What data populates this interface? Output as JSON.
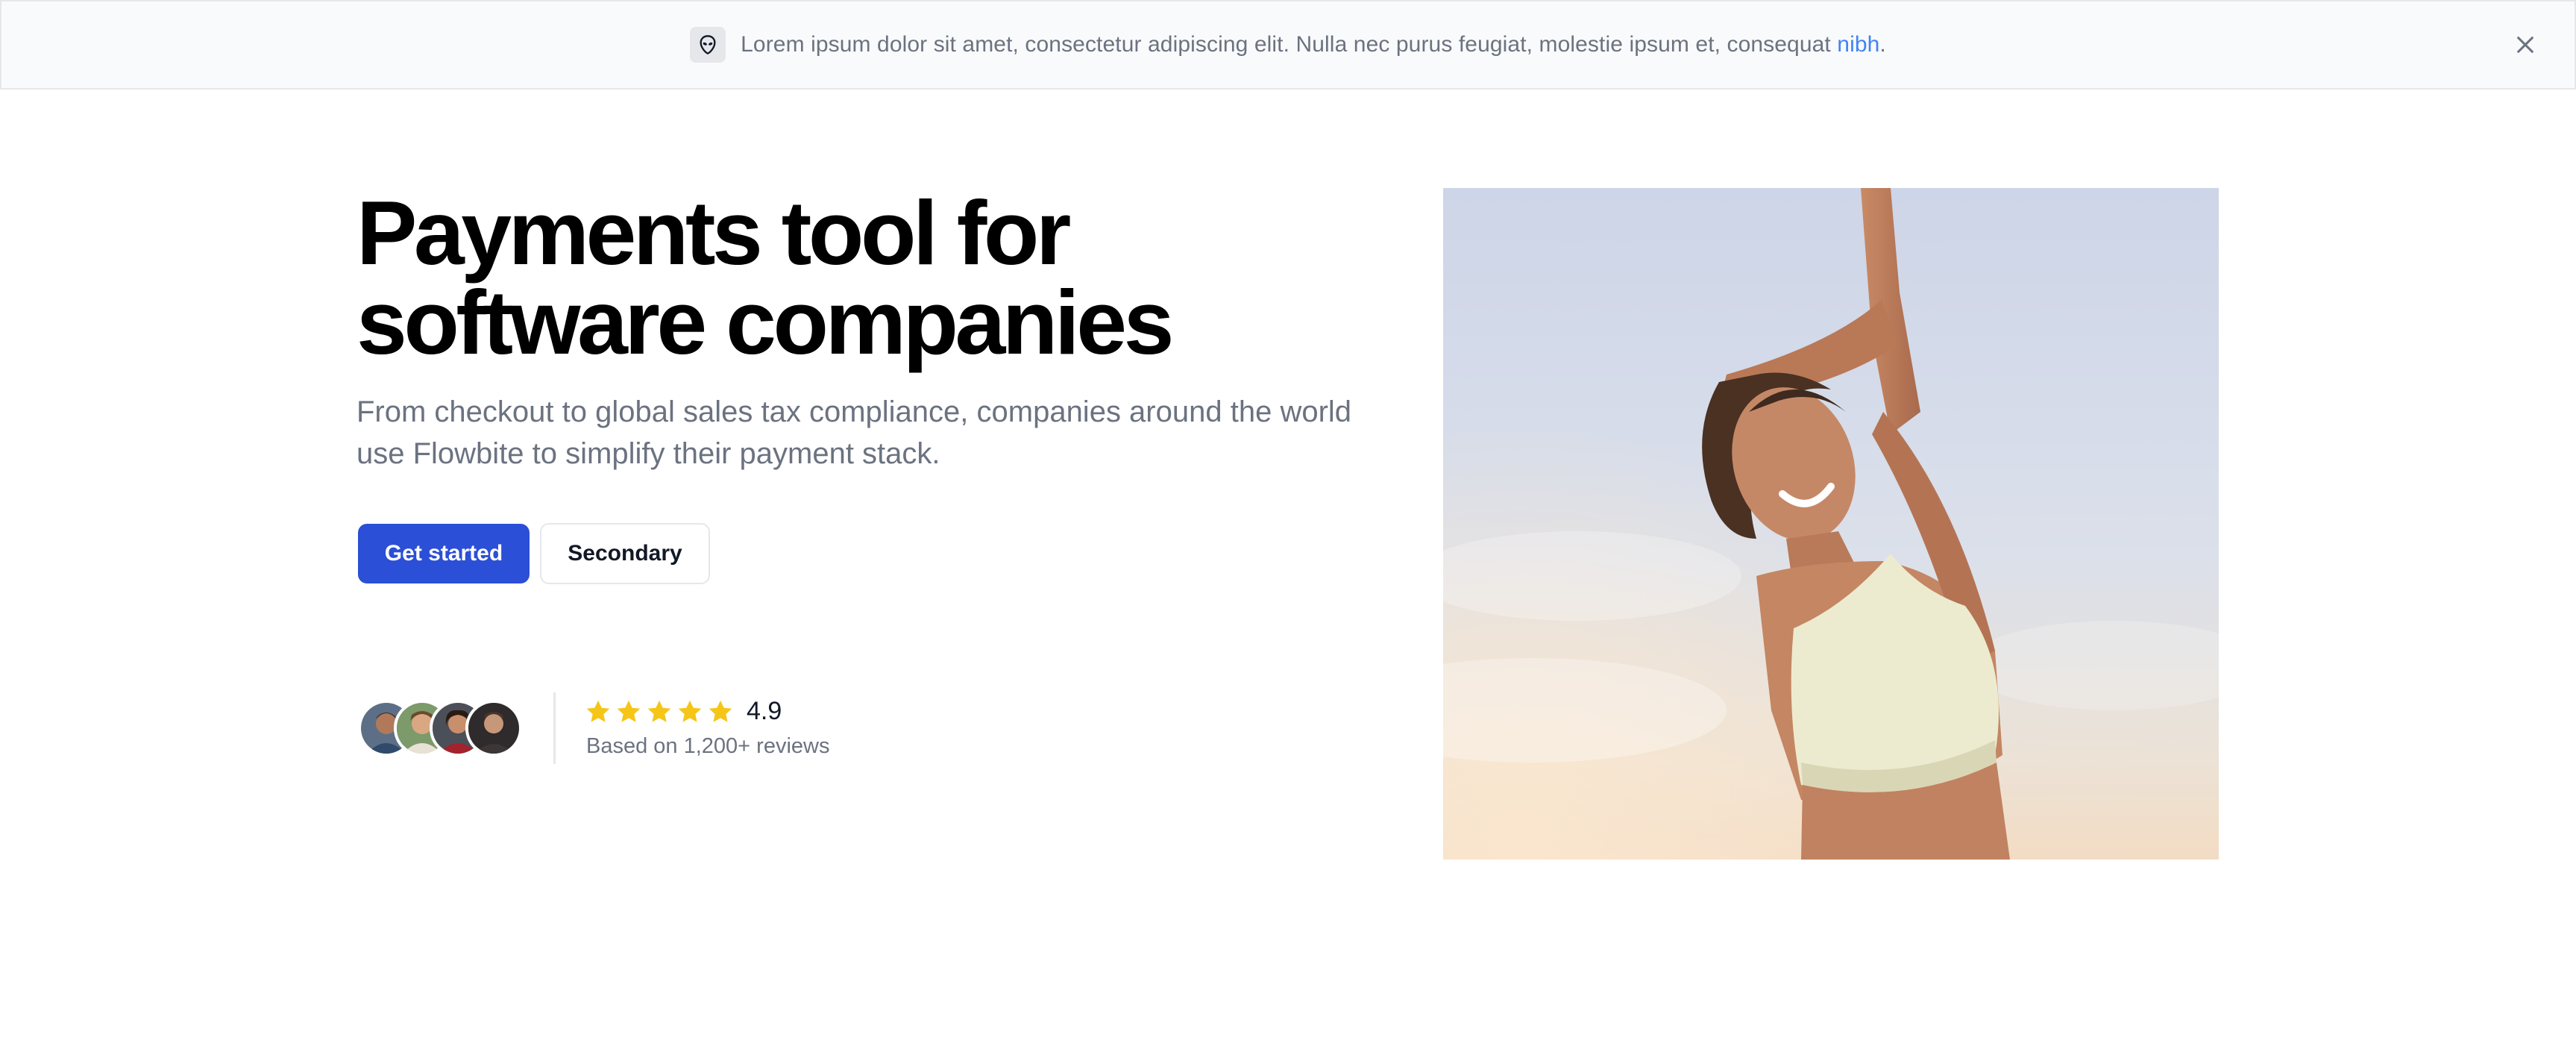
{
  "banner": {
    "icon": "alien-icon",
    "text": "Lorem ipsum dolor sit amet, consectetur adipiscing elit. Nulla nec purus feugiat, molestie ipsum et, consequat ",
    "link_text": "nibh",
    "trailing": ".",
    "close_icon": "close-icon"
  },
  "hero": {
    "title_line1": "Payments tool for",
    "title_line2": "software companies",
    "subtitle_line1": "From checkout to global sales tax compliance, companies around the world",
    "subtitle_line2": "use Flowbite to simplify their payment stack.",
    "primary_button": "Get started",
    "secondary_button": "Secondary"
  },
  "reviews": {
    "avatars": [
      "avatar-1",
      "avatar-2",
      "avatar-3",
      "avatar-4"
    ],
    "stars": 5,
    "rating": "4.9",
    "caption": "Based on 1,200+ reviews"
  },
  "colors": {
    "primary": "#2b4fd6",
    "star": "#f5c518",
    "link": "#3f83f8",
    "muted_text": "#6b7280"
  }
}
